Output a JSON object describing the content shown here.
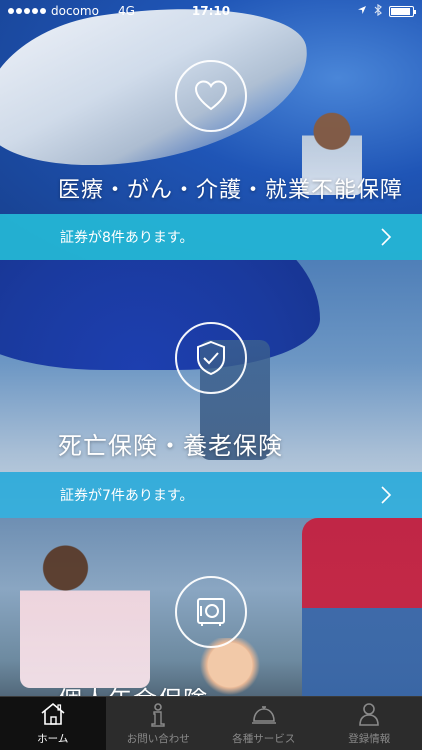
{
  "status_bar": {
    "carrier": "docomo",
    "network": "4G",
    "time": "17:10",
    "icons": [
      "location-icon",
      "bluetooth-icon",
      "battery-icon"
    ]
  },
  "sections": [
    {
      "title": "医療・がん・介護・就業不能保障",
      "count_text": "証券が8件あります。",
      "icon": "heart-icon"
    },
    {
      "title": "死亡保険・養老保険",
      "count_text": "証券が7件あります。",
      "icon": "shield-check-icon"
    },
    {
      "title": "個人年金保険",
      "icon": "safe-icon"
    }
  ],
  "tabbar": {
    "items": [
      {
        "label": "ホーム",
        "icon": "home-icon",
        "active": true
      },
      {
        "label": "お問い合わせ",
        "icon": "info-icon",
        "active": false
      },
      {
        "label": "各種サービス",
        "icon": "service-bell-icon",
        "active": false
      },
      {
        "label": "登録情報",
        "icon": "person-icon",
        "active": false
      }
    ]
  },
  "colors": {
    "accent_bar_1": "#25b8d6",
    "accent_bar_2": "#24a8da",
    "tabbar_bg": "#2c2c2c",
    "tab_active_bg": "#111111"
  }
}
